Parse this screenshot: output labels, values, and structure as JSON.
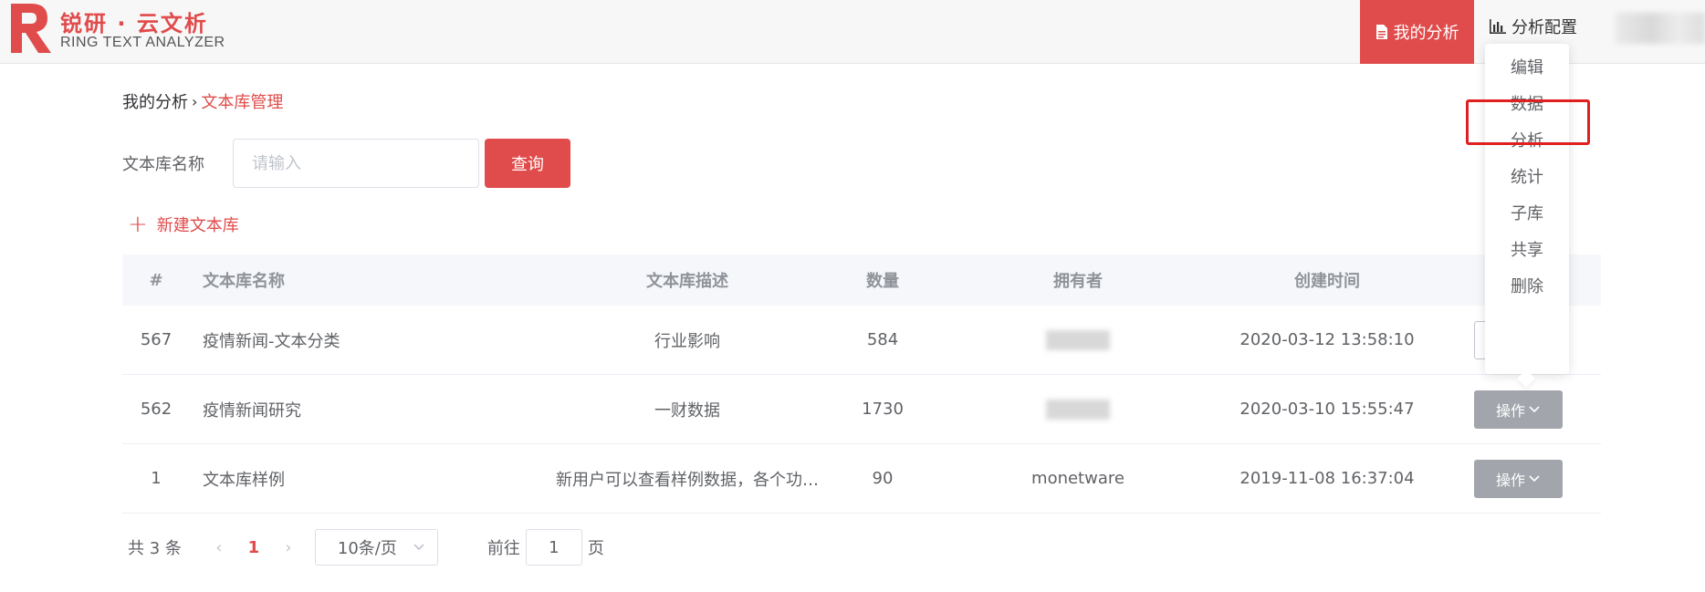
{
  "header": {
    "logo_cn": "锐研 · 云文析",
    "logo_en": "RING TEXT ANALYZER",
    "nav_active": "我的分析",
    "nav_item": "分析配置"
  },
  "breadcrumb": {
    "home": "我的分析",
    "current": "文本库管理"
  },
  "search": {
    "label": "文本库名称",
    "placeholder": "请输入",
    "button": "查询"
  },
  "new_library": "新建文本库",
  "table": {
    "headers": {
      "id": "#",
      "name": "文本库名称",
      "desc": "文本库描述",
      "count": "数量",
      "owner": "拥有者",
      "time": "创建时间"
    },
    "rows": [
      {
        "id": "567",
        "name": "疫情新闻-文本分类",
        "desc": "行业影响",
        "count": "584",
        "owner": "",
        "time": "2020-03-12 13:58:10",
        "op": ""
      },
      {
        "id": "562",
        "name": "疫情新闻研究",
        "desc": "一财数据",
        "count": "1730",
        "owner": "",
        "time": "2020-03-10 15:55:47",
        "op": "操作"
      },
      {
        "id": "1",
        "name": "文本库样例",
        "desc": "新用户可以查看样例数据，各个功…",
        "count": "90",
        "owner": "monetware",
        "time": "2019-11-08 16:37:04",
        "op": "操作"
      }
    ]
  },
  "pagination": {
    "total": "共 3 条",
    "current_page": "1",
    "page_size": "10条/页",
    "goto_label": "前往",
    "goto_value": "1",
    "page_suffix": "页"
  },
  "dropdown": {
    "items": [
      "编辑",
      "数据",
      "分析",
      "统计",
      "子库",
      "共享",
      "删除"
    ],
    "highlighted": "数据"
  },
  "colors": {
    "brand": "#e04b4b",
    "highlight_box": "#e02020",
    "op_button": "#a2a5ab"
  },
  "icons": {
    "nav_active": "document-icon",
    "nav_item": "bar-chart-icon"
  }
}
